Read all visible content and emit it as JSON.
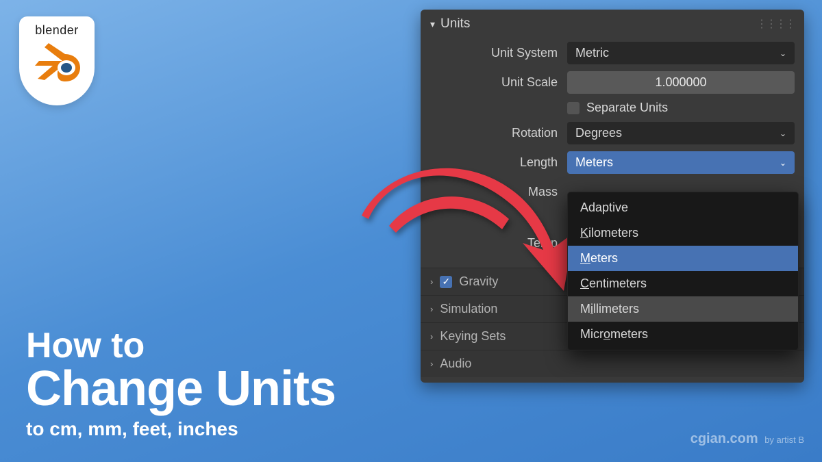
{
  "badge": {
    "text": "blender"
  },
  "title": {
    "line1": "How to",
    "line2": "Change Units",
    "line3": "to cm, mm, feet, inches"
  },
  "credit": {
    "site": "cgian.com",
    "by": "by artist B"
  },
  "panel": {
    "title": "Units",
    "unit_system": {
      "label": "Unit System",
      "value": "Metric"
    },
    "unit_scale": {
      "label": "Unit Scale",
      "value": "1.000000"
    },
    "separate_units": {
      "label": "Separate Units"
    },
    "rotation": {
      "label": "Rotation",
      "value": "Degrees"
    },
    "length": {
      "label": "Length",
      "value": "Meters"
    },
    "mass": {
      "label": "Mass"
    },
    "temperature": {
      "label": "Temp"
    },
    "sections": {
      "gravity": "Gravity",
      "simulation": "Simulation",
      "keying": "Keying Sets",
      "audio": "Audio"
    }
  },
  "menu": {
    "adaptive": "Adaptive",
    "kilometers": "Kilometers",
    "meters": "Meters",
    "centimeters": "Centimeters",
    "millimeters": "Millimeters",
    "micrometers": "Micrometers"
  }
}
